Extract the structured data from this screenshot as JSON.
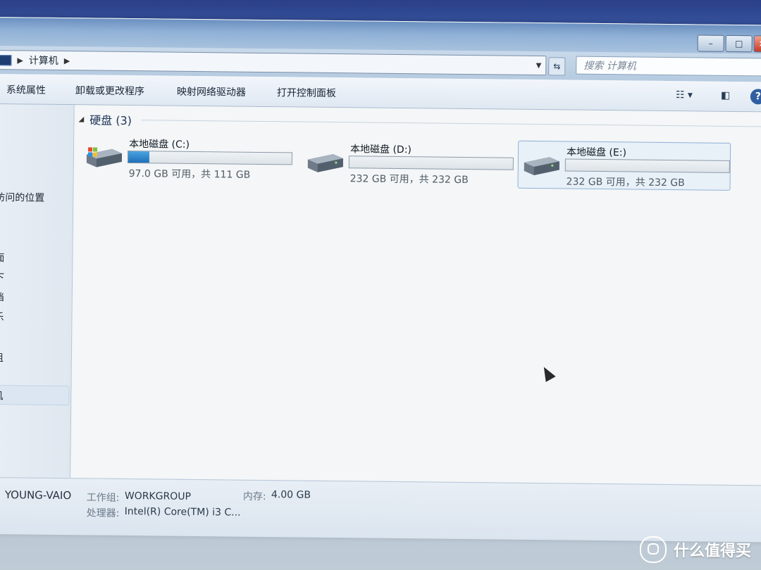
{
  "window": {
    "controls": {
      "minimize": "–",
      "maximize": "□",
      "close": "✕"
    }
  },
  "address": {
    "breadcrumb": [
      "计算机"
    ],
    "search_placeholder": "搜索 计算机"
  },
  "toolbar": {
    "items": [
      "系统属性",
      "卸载或更改程序",
      "映射网络驱动器",
      "打开控制面板"
    ],
    "help_label": "?"
  },
  "nav": {
    "items": [
      "访问的位置",
      "面",
      "下",
      "档",
      "乐",
      "组",
      "机"
    ]
  },
  "content": {
    "group_title": "硬盘 (3)",
    "drives": [
      {
        "name": "本地磁盘 (C:)",
        "info": "97.0 GB 可用，共 111 GB",
        "used_fraction": 0.13,
        "selected": false
      },
      {
        "name": "本地磁盘 (D:)",
        "info": "232 GB 可用，共 232 GB",
        "used_fraction": 0.0,
        "selected": false
      },
      {
        "name": "本地磁盘 (E:)",
        "info": "232 GB 可用，共 232 GB",
        "used_fraction": 0.0,
        "selected": true
      }
    ]
  },
  "details": {
    "computer_name": "YOUNG-VAIO",
    "workgroup_label": "工作组:",
    "workgroup_value": "WORKGROUP",
    "memory_label": "内存:",
    "memory_value": "4.00 GB",
    "processor_label": "处理器:",
    "processor_value": "Intel(R) Core(TM) i3 C..."
  },
  "watermark": {
    "text": "什么值得买"
  },
  "colors": {
    "accent": "#1f6fb8",
    "selection": "#8fb1d6"
  }
}
